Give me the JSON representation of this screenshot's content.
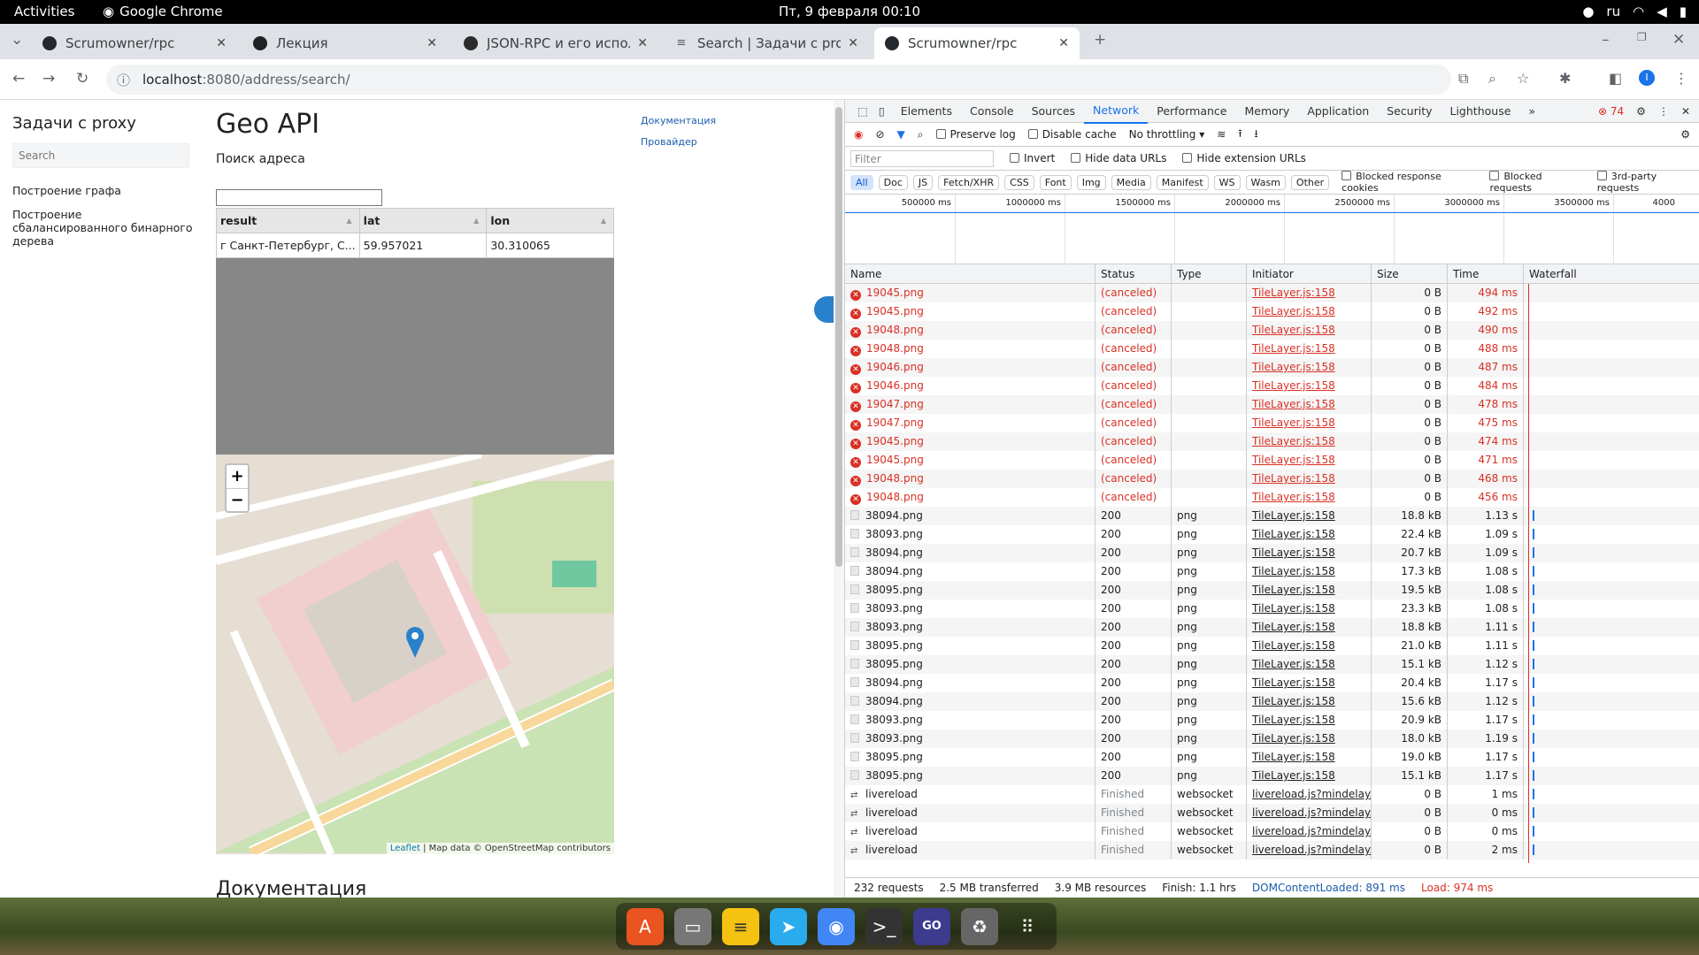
{
  "system": {
    "activities": "Activities",
    "app": "Google Chrome",
    "clock": "Пт, 9 февраля  00:10",
    "lang": "ru"
  },
  "tabs": [
    {
      "title": "Scrumowner/rpc",
      "active": false
    },
    {
      "title": "Лекция",
      "active": false
    },
    {
      "title": "JSON-RPC и его исполь",
      "active": false
    },
    {
      "title": "Search | Задачи с proxy",
      "active": false
    },
    {
      "title": "Scrumowner/rpc",
      "active": true
    }
  ],
  "address": {
    "host": "localhost",
    "path": ":8080/address/search/"
  },
  "site": {
    "brand": "Задачи с proxy",
    "search_placeholder": "Search",
    "menu": [
      "Построение графа",
      "Построение сбалансированного бинарного дерева"
    ],
    "title": "Geo API",
    "subtitle": "Поиск адреса",
    "links": [
      "Документация",
      "Провайдер"
    ],
    "table": {
      "headers": [
        "result",
        "lat",
        "lon"
      ],
      "rows": [
        [
          "г Санкт-Петербург, С...",
          "59.957021",
          "30.310065"
        ]
      ]
    },
    "map": {
      "zoom_in": "+",
      "zoom_out": "−",
      "attr_leaflet": "Leaflet",
      "attr_rest": " | Map data © OpenStreetMap contributors"
    },
    "doc_heading": "Документация"
  },
  "devtools": {
    "tabs": [
      "Elements",
      "Console",
      "Sources",
      "Network",
      "Performance",
      "Memory",
      "Application",
      "Security",
      "Lighthouse"
    ],
    "active_tab": "Network",
    "error_count": "74",
    "toolbar": {
      "preserve_log": "Preserve log",
      "disable_cache": "Disable cache",
      "throttling": "No throttling"
    },
    "filter": {
      "placeholder": "Filter",
      "invert": "Invert",
      "hide_data": "Hide data URLs",
      "hide_ext": "Hide extension URLs"
    },
    "types": [
      "All",
      "Doc",
      "JS",
      "Fetch/XHR",
      "CSS",
      "Font",
      "Img",
      "Media",
      "Manifest",
      "WS",
      "Wasm",
      "Other"
    ],
    "type_checks": [
      "Blocked response cookies",
      "Blocked requests",
      "3rd-party requests"
    ],
    "timeline_ticks": [
      "500000 ms",
      "1000000 ms",
      "1500000 ms",
      "2000000 ms",
      "2500000 ms",
      "3000000 ms",
      "3500000 ms",
      "4000"
    ],
    "columns": [
      "Name",
      "Status",
      "Type",
      "Initiator",
      "Size",
      "Time",
      "Waterfall"
    ],
    "requests": [
      {
        "name": "19045.png",
        "status": "(canceled)",
        "type": "",
        "initiator": "TileLayer.js:158",
        "size": "0 B",
        "time": "494 ms",
        "kind": "err"
      },
      {
        "name": "19045.png",
        "status": "(canceled)",
        "type": "",
        "initiator": "TileLayer.js:158",
        "size": "0 B",
        "time": "492 ms",
        "kind": "err"
      },
      {
        "name": "19048.png",
        "status": "(canceled)",
        "type": "",
        "initiator": "TileLayer.js:158",
        "size": "0 B",
        "time": "490 ms",
        "kind": "err"
      },
      {
        "name": "19048.png",
        "status": "(canceled)",
        "type": "",
        "initiator": "TileLayer.js:158",
        "size": "0 B",
        "time": "488 ms",
        "kind": "err"
      },
      {
        "name": "19046.png",
        "status": "(canceled)",
        "type": "",
        "initiator": "TileLayer.js:158",
        "size": "0 B",
        "time": "487 ms",
        "kind": "err"
      },
      {
        "name": "19046.png",
        "status": "(canceled)",
        "type": "",
        "initiator": "TileLayer.js:158",
        "size": "0 B",
        "time": "484 ms",
        "kind": "err"
      },
      {
        "name": "19047.png",
        "status": "(canceled)",
        "type": "",
        "initiator": "TileLayer.js:158",
        "size": "0 B",
        "time": "478 ms",
        "kind": "err"
      },
      {
        "name": "19047.png",
        "status": "(canceled)",
        "type": "",
        "initiator": "TileLayer.js:158",
        "size": "0 B",
        "time": "475 ms",
        "kind": "err"
      },
      {
        "name": "19045.png",
        "status": "(canceled)",
        "type": "",
        "initiator": "TileLayer.js:158",
        "size": "0 B",
        "time": "474 ms",
        "kind": "err"
      },
      {
        "name": "19045.png",
        "status": "(canceled)",
        "type": "",
        "initiator": "TileLayer.js:158",
        "size": "0 B",
        "time": "471 ms",
        "kind": "err"
      },
      {
        "name": "19048.png",
        "status": "(canceled)",
        "type": "",
        "initiator": "TileLayer.js:158",
        "size": "0 B",
        "time": "468 ms",
        "kind": "err"
      },
      {
        "name": "19048.png",
        "status": "(canceled)",
        "type": "",
        "initiator": "TileLayer.js:158",
        "size": "0 B",
        "time": "456 ms",
        "kind": "err"
      },
      {
        "name": "38094.png",
        "status": "200",
        "type": "png",
        "initiator": "TileLayer.js:158",
        "size": "18.8 kB",
        "time": "1.13 s",
        "kind": "ok"
      },
      {
        "name": "38093.png",
        "status": "200",
        "type": "png",
        "initiator": "TileLayer.js:158",
        "size": "22.4 kB",
        "time": "1.09 s",
        "kind": "ok"
      },
      {
        "name": "38094.png",
        "status": "200",
        "type": "png",
        "initiator": "TileLayer.js:158",
        "size": "20.7 kB",
        "time": "1.09 s",
        "kind": "ok"
      },
      {
        "name": "38094.png",
        "status": "200",
        "type": "png",
        "initiator": "TileLayer.js:158",
        "size": "17.3 kB",
        "time": "1.08 s",
        "kind": "ok"
      },
      {
        "name": "38095.png",
        "status": "200",
        "type": "png",
        "initiator": "TileLayer.js:158",
        "size": "19.5 kB",
        "time": "1.08 s",
        "kind": "ok"
      },
      {
        "name": "38093.png",
        "status": "200",
        "type": "png",
        "initiator": "TileLayer.js:158",
        "size": "23.3 kB",
        "time": "1.08 s",
        "kind": "ok"
      },
      {
        "name": "38093.png",
        "status": "200",
        "type": "png",
        "initiator": "TileLayer.js:158",
        "size": "18.8 kB",
        "time": "1.11 s",
        "kind": "ok"
      },
      {
        "name": "38095.png",
        "status": "200",
        "type": "png",
        "initiator": "TileLayer.js:158",
        "size": "21.0 kB",
        "time": "1.11 s",
        "kind": "ok"
      },
      {
        "name": "38095.png",
        "status": "200",
        "type": "png",
        "initiator": "TileLayer.js:158",
        "size": "15.1 kB",
        "time": "1.12 s",
        "kind": "ok"
      },
      {
        "name": "38094.png",
        "status": "200",
        "type": "png",
        "initiator": "TileLayer.js:158",
        "size": "20.4 kB",
        "time": "1.17 s",
        "kind": "ok"
      },
      {
        "name": "38094.png",
        "status": "200",
        "type": "png",
        "initiator": "TileLayer.js:158",
        "size": "15.6 kB",
        "time": "1.12 s",
        "kind": "ok"
      },
      {
        "name": "38093.png",
        "status": "200",
        "type": "png",
        "initiator": "TileLayer.js:158",
        "size": "20.9 kB",
        "time": "1.17 s",
        "kind": "ok"
      },
      {
        "name": "38093.png",
        "status": "200",
        "type": "png",
        "initiator": "TileLayer.js:158",
        "size": "18.0 kB",
        "time": "1.19 s",
        "kind": "ok"
      },
      {
        "name": "38095.png",
        "status": "200",
        "type": "png",
        "initiator": "TileLayer.js:158",
        "size": "19.0 kB",
        "time": "1.17 s",
        "kind": "ok"
      },
      {
        "name": "38095.png",
        "status": "200",
        "type": "png",
        "initiator": "TileLayer.js:158",
        "size": "15.1 kB",
        "time": "1.17 s",
        "kind": "ok"
      },
      {
        "name": "livereload",
        "status": "Finished",
        "type": "websocket",
        "initiator": "livereload.js?mindelay...",
        "size": "0 B",
        "time": "1 ms",
        "kind": "ws"
      },
      {
        "name": "livereload",
        "status": "Finished",
        "type": "websocket",
        "initiator": "livereload.js?mindelay...",
        "size": "0 B",
        "time": "0 ms",
        "kind": "ws"
      },
      {
        "name": "livereload",
        "status": "Finished",
        "type": "websocket",
        "initiator": "livereload.js?mindelay...",
        "size": "0 B",
        "time": "0 ms",
        "kind": "ws"
      },
      {
        "name": "livereload",
        "status": "Finished",
        "type": "websocket",
        "initiator": "livereload.js?mindelay...",
        "size": "0 B",
        "time": "2 ms",
        "kind": "ws"
      }
    ],
    "summary": {
      "requests": "232 requests",
      "transferred": "2.5 MB transferred",
      "resources": "3.9 MB resources",
      "finish": "Finish: 1.1 hrs",
      "dcl": "DOMContentLoaded: 891 ms",
      "load": "Load: 974 ms"
    }
  },
  "colors": {
    "error": "#d93025",
    "accent": "#1a73e8",
    "link": "#1a5dab"
  }
}
